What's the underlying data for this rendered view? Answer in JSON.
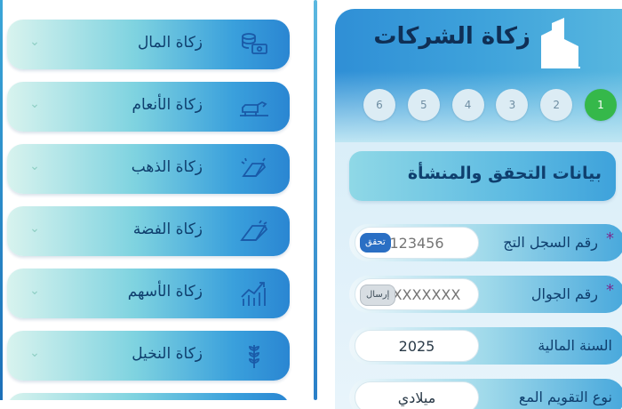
{
  "left_menu": {
    "items": [
      {
        "label": "زكاة المال",
        "icon": "money-stack-icon"
      },
      {
        "label": "زكاة الأنعام",
        "icon": "livestock-icon"
      },
      {
        "label": "زكاة الذهب",
        "icon": "gold-bar-icon"
      },
      {
        "label": "زكاة الفضة",
        "icon": "silver-bar-icon"
      },
      {
        "label": "زكاة الأسهم",
        "icon": "stocks-chart-icon"
      },
      {
        "label": "زكاة النخيل",
        "icon": "wheat-icon"
      }
    ]
  },
  "company_form": {
    "title": "زكاة الشركات",
    "logo_icon": "building-icon",
    "steps": [
      "6",
      "5",
      "4",
      "3",
      "2",
      "1"
    ],
    "active_step": "1",
    "section_title": "بيانات التحقق والمنشأة",
    "fields": {
      "registry": {
        "label": "رقم السجل التج",
        "value": "",
        "placeholder": "123456",
        "button": "تحقق"
      },
      "mobile": {
        "label": "رقم الجوال",
        "value": "",
        "placeholder": "XXXXXXXXX",
        "button": "إرسال"
      },
      "fiscal_year": {
        "label": "السنة المالية",
        "value": "2025"
      },
      "calendar": {
        "label": "نوع التقويم المع",
        "value": "ميلادي"
      }
    }
  },
  "colors": {
    "accent_blue": "#2f8fd6",
    "active_step_green": "#35b84a",
    "text_navy": "#0f3f6e"
  }
}
